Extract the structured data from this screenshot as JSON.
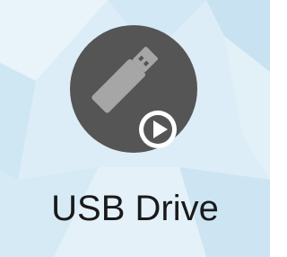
{
  "desktop": {
    "background_color": "#dcedf7",
    "shortcut": {
      "label": "USB Drive",
      "icon": "usb-drive-icon",
      "badge_icon": "play-icon",
      "colors": {
        "circle": "#555555",
        "usb_body": "#a6a6a6",
        "label_text": "#1a1a1a",
        "badge": "#ffffff"
      }
    }
  }
}
